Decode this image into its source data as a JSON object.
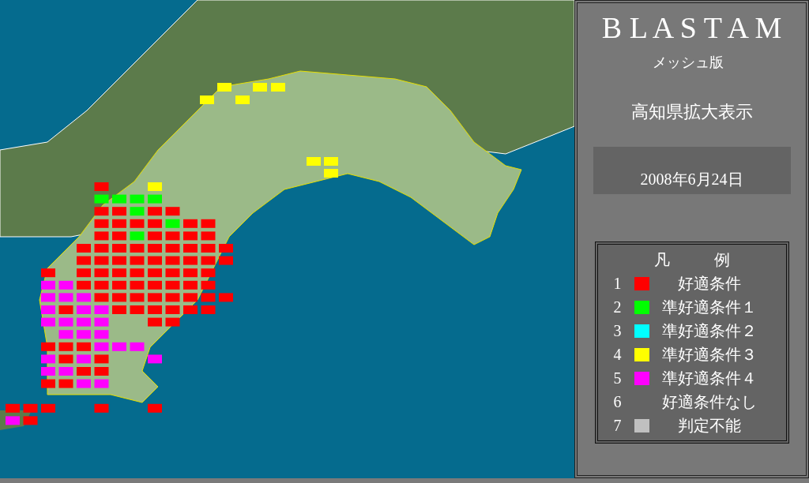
{
  "title": "B L A S T A M",
  "subtitle": "メッシュ版",
  "view": "高知県拡大表示",
  "date": "2008年6月24日",
  "legend": {
    "title": [
      "凡",
      "例"
    ],
    "items": [
      {
        "number": "1",
        "color": "#ff0000",
        "label": "好適条件"
      },
      {
        "number": "2",
        "color": "#00ff00",
        "label": "準好適条件１"
      },
      {
        "number": "3",
        "color": "#00ffff",
        "label": "準好適条件２"
      },
      {
        "number": "4",
        "color": "#ffff00",
        "label": "準好適条件３"
      },
      {
        "number": "5",
        "color": "#ff00ff",
        "label": "準好適条件４"
      },
      {
        "number": "6",
        "label": "好適条件なし"
      },
      {
        "number": "7",
        "color": "#c0c0c0",
        "label": "判定不能"
      }
    ]
  }
}
